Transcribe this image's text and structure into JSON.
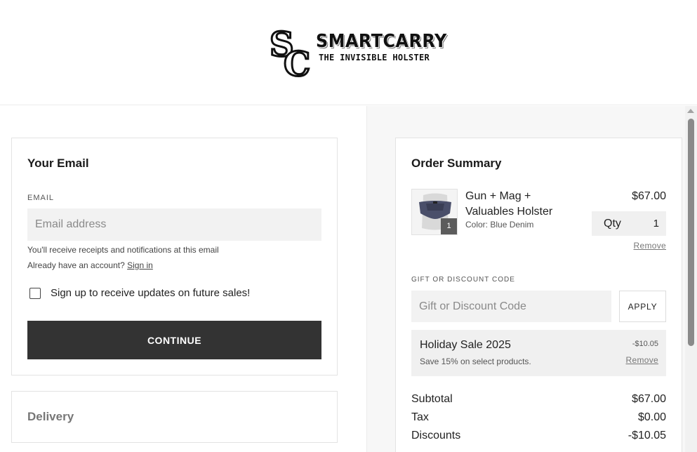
{
  "header": {
    "logo_title": "SMARTCARRY",
    "logo_subtitle": "THE INVISIBLE HOLSTER",
    "logo_monogram": "SC"
  },
  "email_section": {
    "title": "Your Email",
    "field_label": "EMAIL",
    "placeholder": "Email address",
    "value": "",
    "helper_text": "You'll receive receipts and notifications at this email",
    "account_prompt": "Already have an account?",
    "sign_in_label": "Sign in",
    "newsletter_label": "Sign up to receive updates on future sales!",
    "newsletter_checked": false,
    "continue_label": "CONTINUE"
  },
  "delivery_section": {
    "title": "Delivery"
  },
  "order_summary": {
    "title": "Order Summary",
    "item": {
      "name": "Gun + Mag + Valuables Holster",
      "variant": "Color: Blue Denim",
      "price": "$67.00",
      "quantity_badge": "1",
      "qty_label": "Qty",
      "qty_value": "1",
      "remove_label": "Remove"
    },
    "discount_label": "GIFT OR DISCOUNT CODE",
    "discount_placeholder": "Gift or Discount Code",
    "apply_label": "APPLY",
    "promo": {
      "name": "Holiday Sale 2025",
      "description": "Save 15% on select products.",
      "amount": "-$10.05",
      "remove_label": "Remove"
    },
    "totals": [
      {
        "label": "Subtotal",
        "value": "$67.00"
      },
      {
        "label": "Tax",
        "value": "$0.00"
      },
      {
        "label": "Discounts",
        "value": "-$10.05"
      }
    ]
  },
  "colors": {
    "button_dark": "#333333",
    "pane_background": "#f7f7f7",
    "input_background": "#f2f2f2"
  }
}
